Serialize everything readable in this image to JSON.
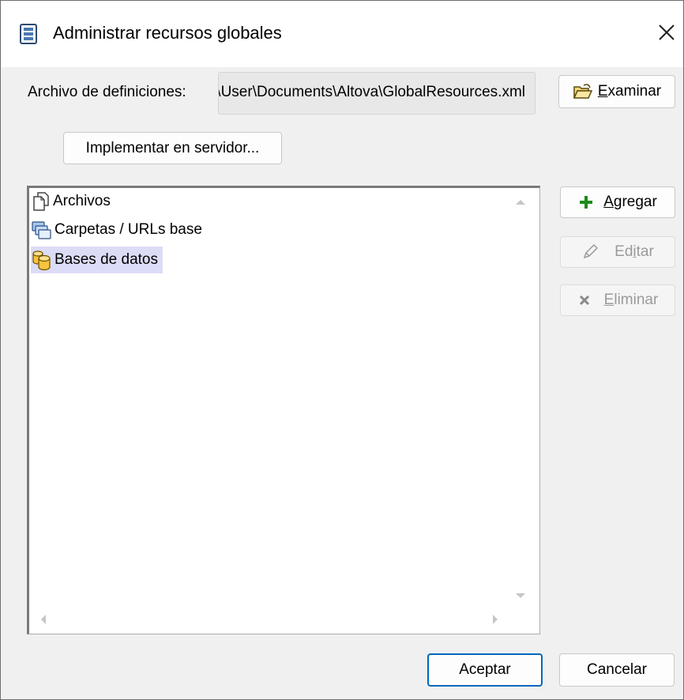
{
  "window": {
    "title": "Administrar recursos globales",
    "close_glyph": "✕"
  },
  "definitions": {
    "label": "Archivo de definiciones:",
    "path": "C:\\Users\\User\\Documents\\Altova\\GlobalResources.xml",
    "browse_label_mnemonic": "E",
    "browse_label_rest": "xaminar"
  },
  "deploy_label": "Implementar en servidor...",
  "tree": {
    "items": [
      {
        "label": "Archivos",
        "icon": "files-icon"
      },
      {
        "label": "Carpetas / URLs base",
        "icon": "folders-icon"
      },
      {
        "label": "Bases de datos",
        "icon": "database-icon",
        "selected": true
      }
    ]
  },
  "side_buttons": {
    "add_mnemonic": "A",
    "add_rest": "gregar",
    "edit_pre": "Ed",
    "edit_mnemonic": "i",
    "edit_rest": "tar",
    "delete_mnemonic": "E",
    "delete_rest": "liminar"
  },
  "footer": {
    "ok_label": "Aceptar",
    "cancel_label": "Cancelar"
  },
  "colors": {
    "accent": "#0067c0",
    "add_green": "#1a8c1a",
    "selection": "#dcdcf7"
  }
}
